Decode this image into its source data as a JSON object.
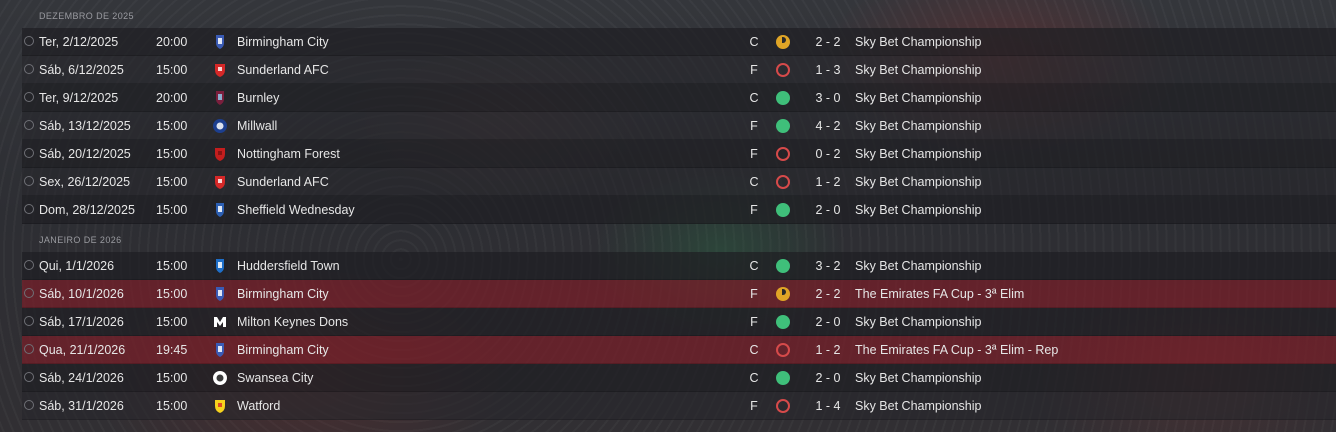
{
  "sections": [
    {
      "month": "DEZEMBRO DE 2025",
      "matches": [
        {
          "date": "Ter, 2/12/2025",
          "time": "20:00",
          "team": "Birmingham City",
          "crest": "birmingham-crest",
          "venue": "C",
          "result": "draw",
          "score": "2 - 2",
          "competition": "Sky Bet Championship"
        },
        {
          "date": "Sáb, 6/12/2025",
          "time": "15:00",
          "team": "Sunderland AFC",
          "crest": "sunderland-crest",
          "venue": "F",
          "result": "loss",
          "score": "1 - 3",
          "competition": "Sky Bet Championship"
        },
        {
          "date": "Ter, 9/12/2025",
          "time": "20:00",
          "team": "Burnley",
          "crest": "burnley-crest",
          "venue": "C",
          "result": "win",
          "score": "3 - 0",
          "competition": "Sky Bet Championship"
        },
        {
          "date": "Sáb, 13/12/2025",
          "time": "15:00",
          "team": "Millwall",
          "crest": "millwall-crest",
          "venue": "F",
          "result": "win",
          "score": "4 - 2",
          "competition": "Sky Bet Championship"
        },
        {
          "date": "Sáb, 20/12/2025",
          "time": "15:00",
          "team": "Nottingham Forest",
          "crest": "nottingham-crest",
          "venue": "F",
          "result": "loss",
          "score": "0 - 2",
          "competition": "Sky Bet Championship"
        },
        {
          "date": "Sex, 26/12/2025",
          "time": "15:00",
          "team": "Sunderland AFC",
          "crest": "sunderland-crest",
          "venue": "C",
          "result": "loss",
          "score": "1 - 2",
          "competition": "Sky Bet Championship"
        },
        {
          "date": "Dom, 28/12/2025",
          "time": "15:00",
          "team": "Sheffield Wednesday",
          "crest": "sheffield-wednesday-crest",
          "venue": "F",
          "result": "win",
          "score": "2 - 0",
          "competition": "Sky Bet Championship"
        }
      ]
    },
    {
      "month": "JANEIRO DE 2026",
      "matches": [
        {
          "date": "Qui, 1/1/2026",
          "time": "15:00",
          "team": "Huddersfield Town",
          "crest": "huddersfield-crest",
          "venue": "C",
          "result": "win",
          "score": "3 - 2",
          "competition": "Sky Bet Championship"
        },
        {
          "date": "Sáb, 10/1/2026",
          "time": "15:00",
          "team": "Birmingham City",
          "crest": "birmingham-crest",
          "venue": "F",
          "result": "draw",
          "score": "2 - 2",
          "competition": "The Emirates FA Cup - 3ª Elim",
          "highlight": true
        },
        {
          "date": "Sáb, 17/1/2026",
          "time": "15:00",
          "team": "Milton Keynes Dons",
          "crest": "mk-dons-crest",
          "venue": "F",
          "result": "win",
          "score": "2 - 0",
          "competition": "Sky Bet Championship"
        },
        {
          "date": "Qua, 21/1/2026",
          "time": "19:45",
          "team": "Birmingham City",
          "crest": "birmingham-crest",
          "venue": "C",
          "result": "loss",
          "score": "1 - 2",
          "competition": "The Emirates FA Cup - 3ª Elim - Rep",
          "highlight": true
        },
        {
          "date": "Sáb, 24/1/2026",
          "time": "15:00",
          "team": "Swansea City",
          "crest": "swansea-crest",
          "venue": "C",
          "result": "win",
          "score": "2 - 0",
          "competition": "Sky Bet Championship"
        },
        {
          "date": "Sáb, 31/1/2026",
          "time": "15:00",
          "team": "Watford",
          "crest": "watford-crest",
          "venue": "F",
          "result": "loss",
          "score": "1 - 4",
          "competition": "Sky Bet Championship"
        }
      ]
    }
  ],
  "colors": {
    "win": "#3fbf7a",
    "loss": "#d64a4a",
    "draw": "#e0a526",
    "highlight_row": "#781e28"
  },
  "crest_colors": {
    "birmingham-crest": [
      "#3a5bb5",
      "#ffffff"
    ],
    "sunderland-crest": [
      "#d62828",
      "#ffffff"
    ],
    "burnley-crest": [
      "#7a1f3d",
      "#8fc8e8"
    ],
    "millwall-crest": [
      "#1d3f8f",
      "#ffffff"
    ],
    "nottingham-crest": [
      "#c41e1e",
      "#7a1010"
    ],
    "sheffield-wednesday-crest": [
      "#2c5fb3",
      "#ffffff"
    ],
    "huddersfield-crest": [
      "#1e6fc9",
      "#ffffff"
    ],
    "mk-dons-crest": [
      "#ffffff",
      "#1a1a1a"
    ],
    "swansea-crest": [
      "#ffffff",
      "#1a1a1a"
    ],
    "watford-crest": [
      "#f6d21d",
      "#d62828"
    ]
  }
}
